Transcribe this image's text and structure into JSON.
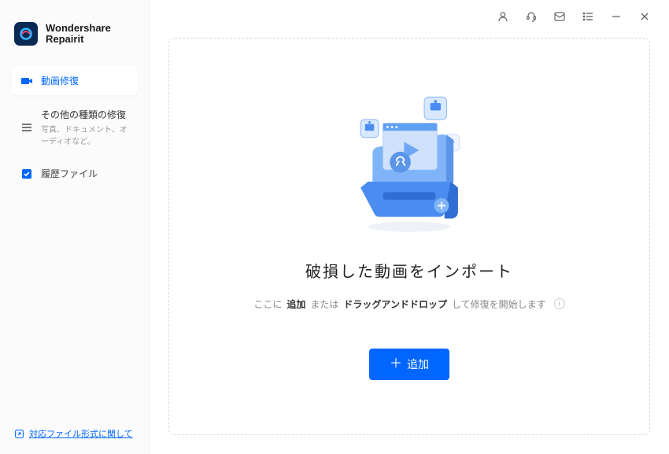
{
  "brand": {
    "line1": "Wondershare",
    "line2": "Repairit"
  },
  "nav": {
    "video": {
      "label": "動画修復"
    },
    "other": {
      "title": "その他の種類の修復",
      "sub": "写真、ドキュメント、オーディオなど。"
    },
    "history": {
      "label": "履歴ファイル"
    }
  },
  "footer_link": "対応ファイル形式に関して",
  "dropzone": {
    "heading": "破損した動画をインポート",
    "sub_pre": "ここに",
    "sub_bold": "追加",
    "sub_mid": "または",
    "sub_bold2": "ドラッグアンドドロップ",
    "sub_post": "して修復を開始します",
    "add_btn": "追加"
  }
}
